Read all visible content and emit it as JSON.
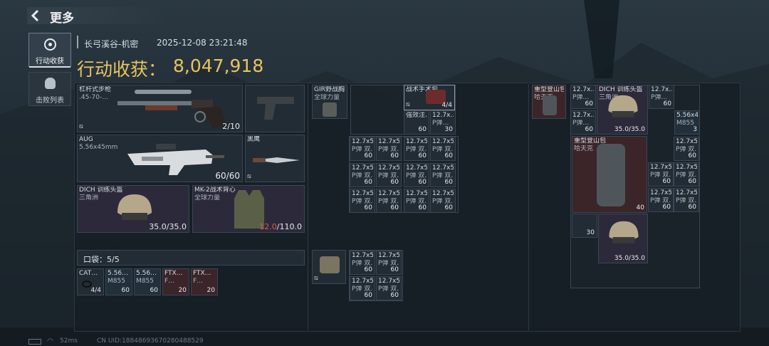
{
  "header": {
    "title": "更多"
  },
  "sidebar": {
    "tabs": [
      {
        "label": "行动收获"
      },
      {
        "label": "击败列表"
      }
    ]
  },
  "info": {
    "map": "长弓溪谷-机密",
    "datetime": "2025-12-08 23:21:48",
    "earnings_label": "行动收获：",
    "earnings_value": "8,047,918"
  },
  "loadout": {
    "primary": {
      "name": "杠杆式步枪",
      "sub": ".45-70-…",
      "count": "2/10"
    },
    "pistol": {
      "name": ""
    },
    "secondary": {
      "name": "AUG",
      "sub": "5.56x45mm",
      "count": "60/60"
    },
    "melee": {
      "name": "黑鹰"
    },
    "helmet": {
      "name": "DICH 训练头盔",
      "sub": "三角洲",
      "durability": "35.0/35.0"
    },
    "armor": {
      "name": "MK-2战术背心",
      "sub": "全球力量",
      "durability_current": "12.0",
      "durability_max": "/110.0"
    },
    "pocket": {
      "label": "口袋：5/5"
    },
    "pocket_items": [
      {
        "name": "CAT…",
        "sub": "",
        "count": "4/4"
      },
      {
        "name": "5.56…",
        "sub": "M855",
        "count": "60"
      },
      {
        "name": "5.56…",
        "sub": "M855",
        "count": "60"
      },
      {
        "name": "FTX…",
        "sub": "F…",
        "count": "20"
      },
      {
        "name": "FTX…",
        "sub": "F…",
        "count": "20"
      }
    ]
  },
  "chest_rig": {
    "name": "GIR野战胸…",
    "sub": "全球力量"
  },
  "rig_items": {
    "medkit": {
      "name": "战术手术包",
      "count": "4/4"
    },
    "injector": {
      "name": "强效注…",
      "count": "60"
    },
    "ammo_top": {
      "name": "12.7x…",
      "sub": "P弹…",
      "count": "30"
    },
    "ammo_name": "12.7x5…",
    "ammo_sub": "P弹 双…",
    "ammo_count": "60"
  },
  "pouch": {
    "name": ""
  },
  "backpack": {
    "name": "重型登山包",
    "sub": "哈夫克",
    "slots_ammo_name": "12.7x…",
    "slots_ammo_sub": "P弹…",
    "slots_ammo_count": "60",
    "helmet_name": "DICH 训练头盔",
    "helmet_sub": "三角洲",
    "helmet_dur": "35.0/35.0",
    "m855_name": "5.56x45…",
    "m855_sub": "M855",
    "m855_count": "3",
    "inner_bag_name": "重型登山包",
    "inner_bag_sub": "哈夫克",
    "inner_bag_count": "40",
    "wide_ammo_name": "12.7x55…",
    "wide_ammo_sub": "P弹 双…",
    "wide_ammo_count": "60",
    "lower_ammo_count": "30",
    "lower_helmet_dur": "35.0/35.0"
  },
  "footer": {
    "ping": "52ms",
    "uid": "CN UID:18848693670280488529"
  }
}
